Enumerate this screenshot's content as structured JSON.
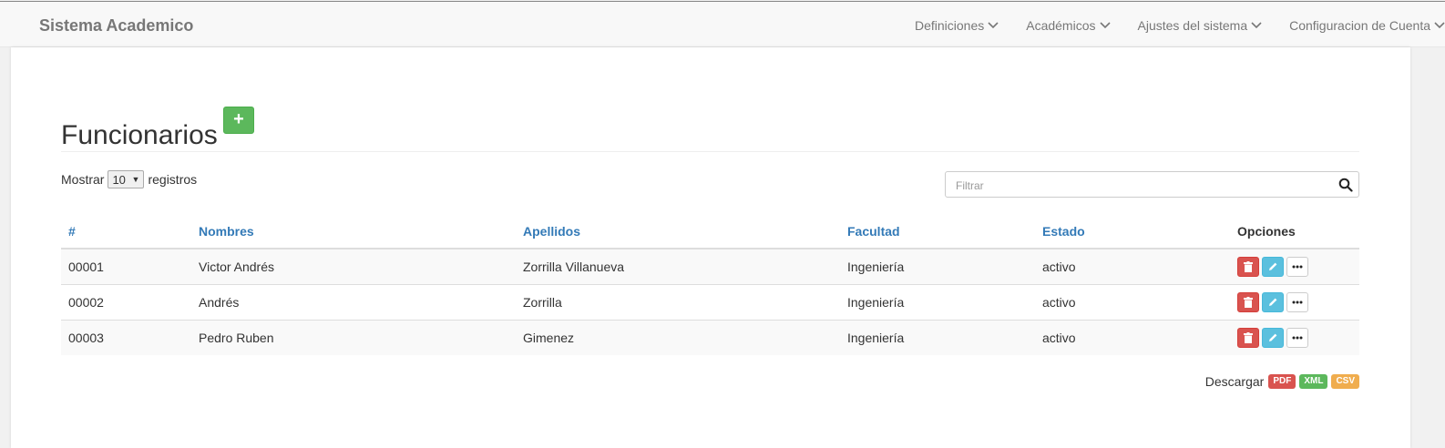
{
  "navbar": {
    "brand": "Sistema Academico",
    "menu": [
      "Definiciones",
      "Académicos",
      "Ajustes del sistema",
      "Configuracion de Cuenta"
    ]
  },
  "page": {
    "title": "Funcionarios",
    "add_icon": "plus-icon"
  },
  "length_menu": {
    "prefix": "Mostrar",
    "value": "10",
    "suffix": "registros"
  },
  "search": {
    "placeholder": "Filtrar",
    "icon": "search-icon"
  },
  "table": {
    "columns": [
      "#",
      "Nombres",
      "Apellidos",
      "Facultad",
      "Estado",
      "Opciones"
    ],
    "rows": [
      {
        "id": "00001",
        "nombres": "Victor Andrés",
        "apellidos": "Zorrilla Villanueva",
        "facultad": "Ingeniería",
        "estado": "activo"
      },
      {
        "id": "00002",
        "nombres": "Andrés",
        "apellidos": "Zorrilla",
        "facultad": "Ingeniería",
        "estado": "activo"
      },
      {
        "id": "00003",
        "nombres": "Pedro Ruben",
        "apellidos": "Gimenez",
        "facultad": "Ingeniería",
        "estado": "activo"
      }
    ],
    "row_actions": [
      "trash-icon",
      "pencil-icon",
      "ellipsis-icon"
    ]
  },
  "downloads": {
    "label": "Descargar",
    "formats": [
      {
        "label": "PDF",
        "color": "#d9534f"
      },
      {
        "label": "XML",
        "color": "#5cb85c"
      },
      {
        "label": "CSV",
        "color": "#f0ad4e"
      }
    ]
  },
  "colors": {
    "link": "#337ab7",
    "success": "#5cb85c",
    "danger": "#d9534f",
    "info": "#5bc0de",
    "warning": "#f0ad4e"
  }
}
